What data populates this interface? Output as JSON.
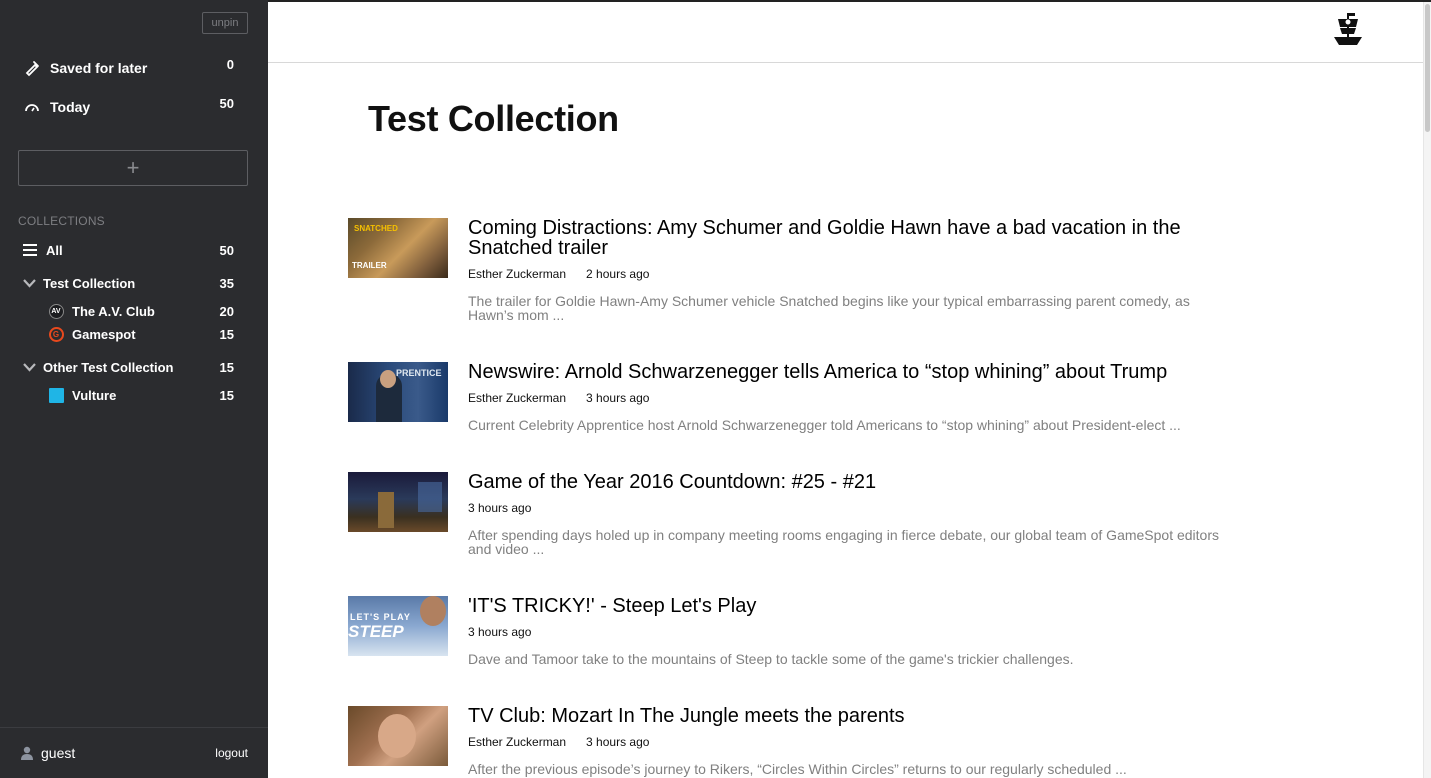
{
  "sidebar": {
    "unpin_label": "unpin",
    "saved": {
      "label": "Saved for later",
      "count": "0"
    },
    "today": {
      "label": "Today",
      "count": "50"
    },
    "add_label": "+",
    "collections_header": "COLLECTIONS",
    "all": {
      "label": "All",
      "count": "50"
    },
    "collections": [
      {
        "label": "Test Collection",
        "count": "35",
        "feeds": [
          {
            "label": "The A.V. Club",
            "count": "20",
            "icon": "avclub-icon"
          },
          {
            "label": "Gamespot",
            "count": "15",
            "icon": "gamespot-icon"
          }
        ]
      },
      {
        "label": "Other Test Collection",
        "count": "15",
        "feeds": [
          {
            "label": "Vulture",
            "count": "15",
            "icon": "vulture-icon"
          }
        ]
      }
    ],
    "footer": {
      "user": "guest",
      "logout": "logout"
    }
  },
  "main": {
    "title": "Test Collection",
    "articles": [
      {
        "title": "Coming Distractions: Amy Schumer and Goldie Hawn have a bad vacation in the Snatched trailer",
        "author": "Esther Zuckerman",
        "time": "2 hours ago",
        "summary": "The trailer for Goldie Hawn-Amy Schumer vehicle Snatched begins like your typical embarrassing parent comedy, as Hawn’s mom ...",
        "thumb_text": "SNATCHED",
        "thumb_sub": "TRAILER"
      },
      {
        "title": "Newswire: Arnold Schwarzenegger tells America to “stop whining” about Trump",
        "author": "Esther Zuckerman",
        "time": "3 hours ago",
        "summary": "Current Celebrity Apprentice host Arnold Schwarzenegger told Americans to “stop whining” about President-elect ...",
        "thumb_text": "PRENTICE"
      },
      {
        "title": "Game of the Year 2016 Countdown: #25 - #21",
        "author": "",
        "time": "3 hours ago",
        "summary": "After spending days holed up in company meeting rooms engaging in fierce debate, our global team of GameSpot editors and video ..."
      },
      {
        "title": "'IT'S TRICKY!' - Steep Let's Play",
        "author": "",
        "time": "3 hours ago",
        "summary": "Dave and Tamoor take to the mountains of Steep to tackle some of the game's trickier challenges.",
        "thumb_text": "LET'S PLAY",
        "thumb_sub": "STEEP"
      },
      {
        "title": "TV Club: Mozart In The Jungle meets the parents",
        "author": "Esther Zuckerman",
        "time": "3 hours ago",
        "summary": "After the previous episode’s journey to Rikers, “Circles Within Circles” returns to our regularly scheduled ..."
      }
    ]
  },
  "colors": {
    "sidebar_bg": "#2b2c2f",
    "gamespot_accent": "#e8491d",
    "vulture_accent": "#1fb5e6"
  }
}
